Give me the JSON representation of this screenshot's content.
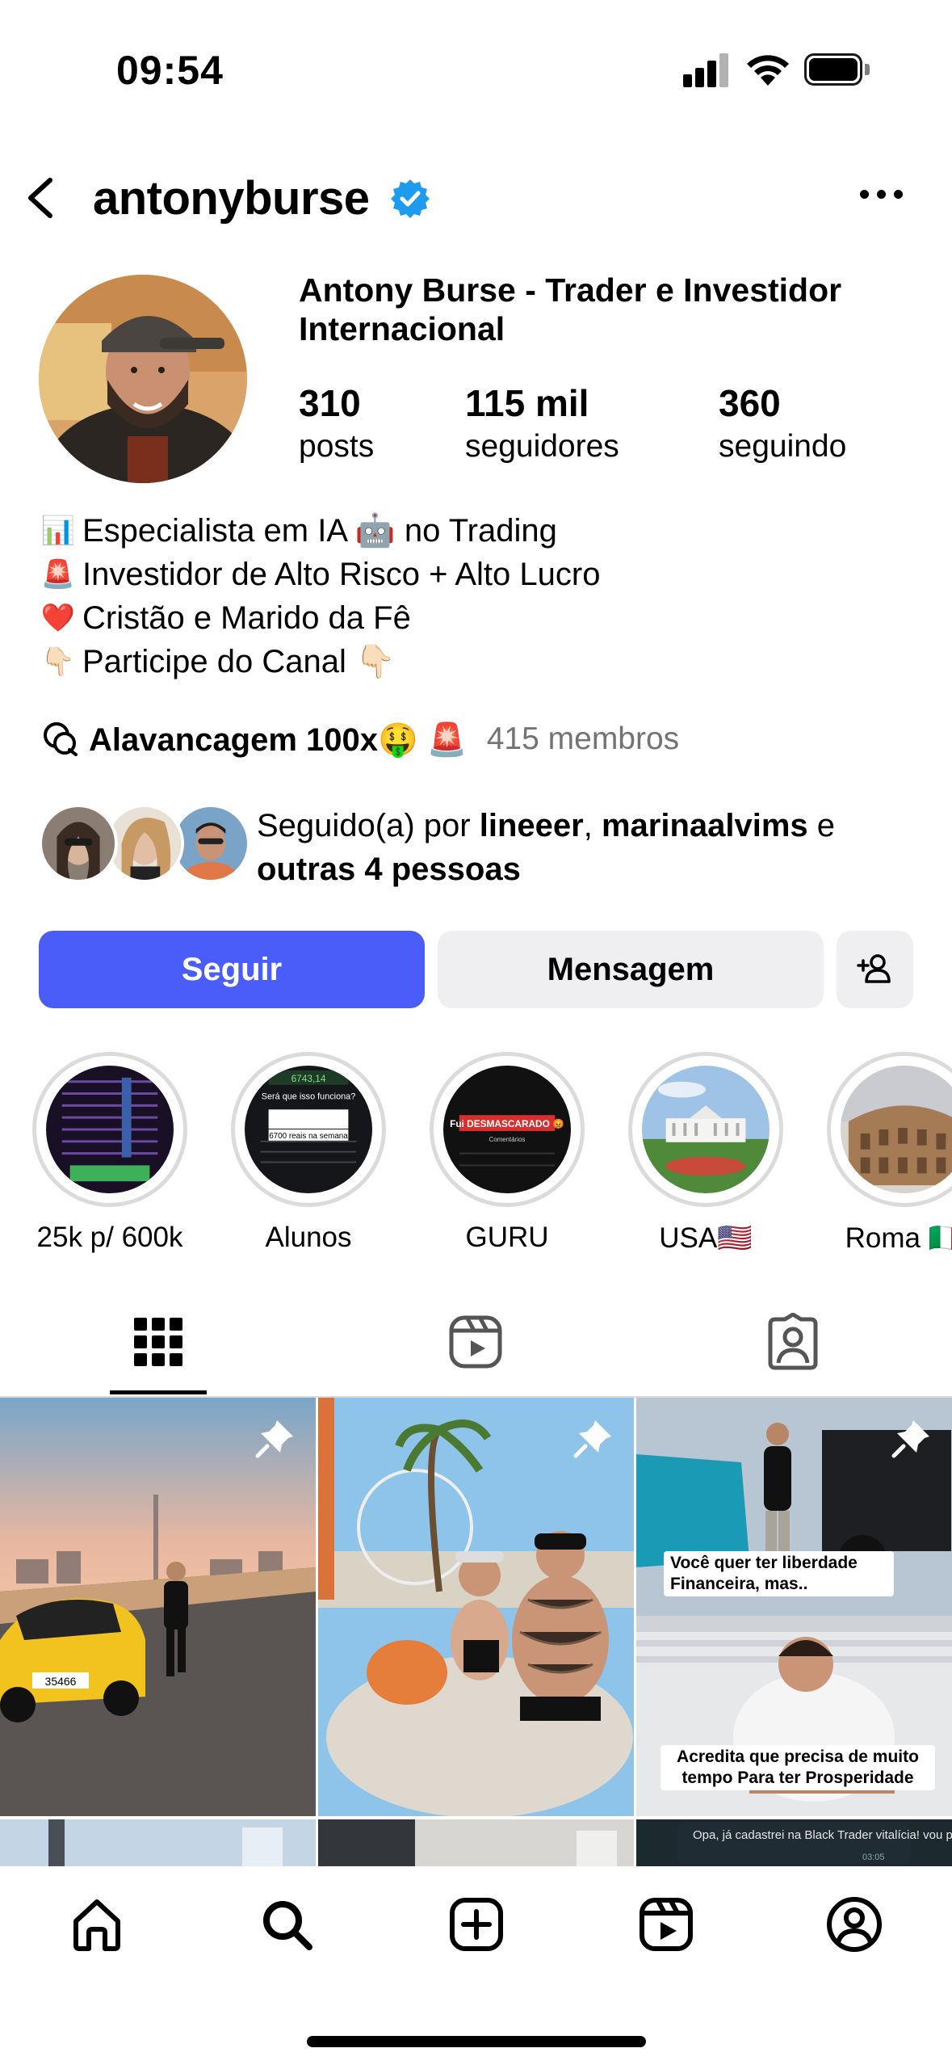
{
  "status_bar": {
    "time": "09:54"
  },
  "header": {
    "username": "antonyburse"
  },
  "profile": {
    "display_name": "Antony Burse - Trader e Investidor Internacional",
    "stats": [
      {
        "value": "310",
        "label": "posts"
      },
      {
        "value": "115 mil",
        "label": "seguidores"
      },
      {
        "value": "360",
        "label": "seguindo"
      }
    ],
    "bio": [
      {
        "emoji": "📊",
        "text": "Especialista em IA 🤖 no Trading"
      },
      {
        "emoji": "🚨",
        "text": "Investidor de Alto Risco + Alto Lucro"
      },
      {
        "emoji": "❤️",
        "text": "Cristão e Marido da Fê"
      },
      {
        "emoji": "👇🏻",
        "text": "Participe do Canal 👇🏻"
      }
    ],
    "channel": {
      "name": "Alavancagem 100x🤑 🚨",
      "members": "415 membros"
    },
    "followed_by": {
      "prefix": "Seguido(a) por",
      "user1": "lineeer",
      "separator": ",",
      "user2": "marinaalvims",
      "conj": "e",
      "others": "outras 4 pessoas"
    }
  },
  "actions": {
    "follow": "Seguir",
    "message": "Mensagem"
  },
  "highlights": [
    {
      "label": "25k p/ 600k"
    },
    {
      "label": "Alunos"
    },
    {
      "label": "GURU"
    },
    {
      "label": "USA🇺🇸"
    },
    {
      "label": "Roma 🇮🇹"
    }
  ],
  "highlight_overlays": {
    "alunos_value": "6743,14",
    "alunos_question": "Será que isso funciona?",
    "alunos_amount": "6700 reais na semana",
    "guru_title": "Fui DESMASCARADO 😡",
    "guru_sub": "Comentários"
  },
  "posts": {
    "post1_plate": "35466",
    "post3_caption1": "Você quer ter liberdade Financeira, mas..",
    "post3_caption2": "Acredita que precisa de muito tempo Para ter Prosperidade",
    "post6_chat": "Opa, já cadastrei na Black Trader vitalícia! vou participar 😀😀😀",
    "post6_time": "03:05"
  },
  "icons": [
    "back-icon",
    "verified-icon",
    "more-icon",
    "threads-icon",
    "add-user-icon",
    "grid-icon",
    "reels-icon",
    "tagged-icon",
    "pin-icon",
    "home-icon",
    "search-icon",
    "create-icon",
    "reels-nav-icon",
    "profile-icon"
  ],
  "colors": {
    "accent": "#4A5DF9",
    "verified": "#1D9BF0",
    "secondary_button": "#EFEFF2",
    "muted_text": "#737373"
  }
}
